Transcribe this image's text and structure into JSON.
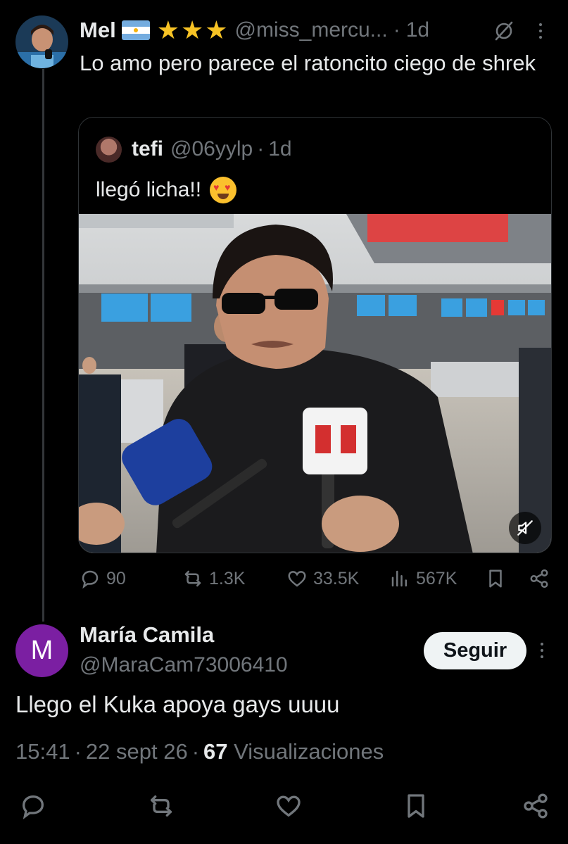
{
  "main_tweet": {
    "name": "Mel",
    "handle": "@miss_mercu...",
    "time": "1d",
    "text": "Lo amo pero parece el ratoncito ciego de shrek"
  },
  "quoted_tweet": {
    "name": "tefi",
    "handle": "@06yylp",
    "time": "1d",
    "text": "llegó licha!!"
  },
  "stats": {
    "replies": "90",
    "reposts": "1.3K",
    "likes": "33.5K",
    "views": "567K"
  },
  "reply_tweet": {
    "avatar_letter": "M",
    "name": "María Camila",
    "handle": "@MaraCam73006410",
    "follow_label": "Seguir",
    "text": "Llego el Kuka apoya gays uuuu",
    "time": "15:41",
    "date": "22 sept 26",
    "views_count": "67",
    "views_label": "Visualizaciones"
  },
  "colors": {
    "background": "#000000",
    "text": "#e7e9ea",
    "muted": "#71767b",
    "avatar_bg": "#7b1fa2",
    "star": "#f7c325"
  },
  "icons": [
    "mute-icon",
    "more-icon",
    "reply-icon",
    "repost-icon",
    "like-icon",
    "views-icon",
    "bookmark-icon",
    "share-icon",
    "video-mute-icon"
  ]
}
